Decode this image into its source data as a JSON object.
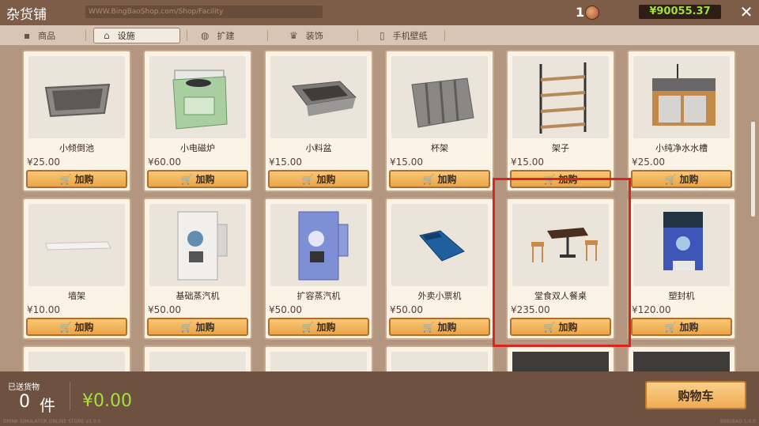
{
  "header": {
    "title": "杂货铺",
    "url": "WWW.BingBaoShop.com/Shop/Facility",
    "coins": "1",
    "money": "¥90055.37",
    "close": "✕"
  },
  "tabs": [
    {
      "label": "商品",
      "icon": "box-icon"
    },
    {
      "label": "设施",
      "icon": "home-icon"
    },
    {
      "label": "扩建",
      "icon": "expand-icon"
    },
    {
      "label": "装饰",
      "icon": "crown-icon"
    },
    {
      "label": "手机壁纸",
      "icon": "phone-icon"
    }
  ],
  "items": [
    {
      "name": "小倾倒池",
      "price": "¥25.00",
      "buy": "加购"
    },
    {
      "name": "小电磁炉",
      "price": "¥60.00",
      "buy": "加购"
    },
    {
      "name": "小料盆",
      "price": "¥15.00",
      "buy": "加购"
    },
    {
      "name": "杯架",
      "price": "¥15.00",
      "buy": "加购"
    },
    {
      "name": "架子",
      "price": "¥15.00",
      "buy": "加购"
    },
    {
      "name": "小纯净水水槽",
      "price": "¥25.00",
      "buy": "加购"
    },
    {
      "name": "墙架",
      "price": "¥10.00",
      "buy": "加购"
    },
    {
      "name": "基础蒸汽机",
      "price": "¥50.00",
      "buy": "加购"
    },
    {
      "name": "扩容蒸汽机",
      "price": "¥50.00",
      "buy": "加购"
    },
    {
      "name": "外卖小票机",
      "price": "¥50.00",
      "buy": "加购"
    },
    {
      "name": "堂食双人餐桌",
      "price": "¥235.00",
      "buy": "加购"
    },
    {
      "name": "塑封机",
      "price": "¥120.00",
      "buy": "加购"
    }
  ],
  "footer": {
    "shipped_label": "已送货物",
    "shipped_count": "0",
    "shipped_unit": "件",
    "total": "¥0.00",
    "cart_button": "购物车",
    "bottom_text": "DRINK SIMULATOR ONLINE STORE V1.0.0",
    "version": "BINGBAO 1.0.0"
  }
}
